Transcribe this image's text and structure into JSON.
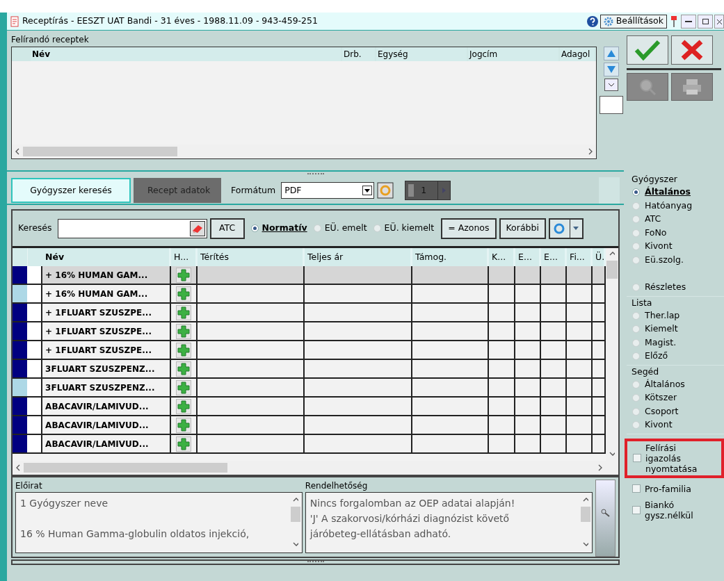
{
  "window": {
    "title": "Receptírás - EESZT UAT Bandi - 31 éves - 1988.11.09 - 943-459-251",
    "settings_button": "Beállítások"
  },
  "prescriptions": {
    "title": "Felírandó receptek",
    "columns": [
      "Név",
      "Drb.",
      "Egység",
      "Jogcím",
      "Adagol"
    ]
  },
  "tabs": [
    {
      "label": "Gyógyszer keresés",
      "selected": true
    },
    {
      "label": "Recept adatok",
      "selected": false
    }
  ],
  "format": {
    "label": "Formátum",
    "value": "PDF",
    "page": "1"
  },
  "search": {
    "label": "Keresés",
    "atc_button": "ATC",
    "modes": [
      {
        "label": "Normatív",
        "selected": true
      },
      {
        "label": "EÜ. emelt",
        "selected": false
      },
      {
        "label": "EÜ. kiemelt",
        "selected": false
      }
    ],
    "buttons": [
      "= Azonos",
      "Korábbi"
    ]
  },
  "results": {
    "columns": [
      "Név",
      "H...",
      "Térítés",
      "Teljes ár",
      "Támog.",
      "K...",
      "E...",
      "E...",
      "Fi...",
      "Ü."
    ],
    "rows": [
      {
        "name": "+ 16% HUMAN GAM...",
        "color": "#000080",
        "selected": true
      },
      {
        "name": "+ 16% HUMAN GAM...",
        "color": "#add8e6",
        "selected": false
      },
      {
        "name": "+ 1FLUART SZUSZPE...",
        "color": "#000080",
        "selected": false
      },
      {
        "name": "+ 1FLUART SZUSZPE...",
        "color": "#000080",
        "selected": false
      },
      {
        "name": "+ 1FLUART SZUSZPE...",
        "color": "#000080",
        "selected": false
      },
      {
        "name": "3FLUART SZUSZPENZ...",
        "color": "#000080",
        "selected": false
      },
      {
        "name": "3FLUART SZUSZPENZ...",
        "color": "#add8e6",
        "selected": false
      },
      {
        "name": "ABACAVIR/LAMIVUD...",
        "color": "#000080",
        "selected": false
      },
      {
        "name": "ABACAVIR/LAMIVUD...",
        "color": "#000080",
        "selected": false
      },
      {
        "name": "ABACAVIR/LAMIVUD...",
        "color": "#000080",
        "selected": false
      }
    ]
  },
  "eloirat": {
    "title": "Előirat",
    "paragraphs": [
      "1 Gyógyszer neve",
      "16 % Human Gamma-globulin oldatos injekció,"
    ]
  },
  "rendelhetoseg": {
    "title": "Rendelhetőség",
    "lines": [
      "Nincs forgalomban az OEP adatai alapján!",
      "'J' A szakorvosi/kórházi diagnózist követő",
      "járóbeteg-ellátásban adható."
    ]
  },
  "side_groups": [
    {
      "title": "Gyógyszer",
      "options": [
        {
          "label": "Általános",
          "selected": true
        },
        {
          "label": "Hatóanyag",
          "selected": false
        },
        {
          "label": "ATC",
          "selected": false
        },
        {
          "label": "FoNo",
          "selected": false
        },
        {
          "label": "Kivont",
          "selected": false
        },
        {
          "label": "Eü.szolg.",
          "selected": false
        }
      ],
      "extra_options": [
        {
          "label": "Részletes",
          "selected": false
        }
      ]
    },
    {
      "title": "Lista",
      "options": [
        {
          "label": "Ther.lap",
          "selected": false
        },
        {
          "label": "Kiemelt",
          "selected": false
        },
        {
          "label": "Magist.",
          "selected": false
        },
        {
          "label": "Előző",
          "selected": false
        }
      ]
    },
    {
      "title": "Segéd",
      "options": [
        {
          "label": "Általános",
          "selected": false
        },
        {
          "label": "Kötszer",
          "selected": false
        },
        {
          "label": "Csoport",
          "selected": false
        },
        {
          "label": "Kivont",
          "selected": false
        }
      ]
    }
  ],
  "checkboxes": [
    {
      "label": "Felírási igazolás nyomtatása",
      "checked": false,
      "highlighted": true
    },
    {
      "label": "Pro-familia",
      "checked": false,
      "highlighted": false
    },
    {
      "label": "Biankó gysz.nélkül",
      "checked": false,
      "highlighted": false
    }
  ]
}
